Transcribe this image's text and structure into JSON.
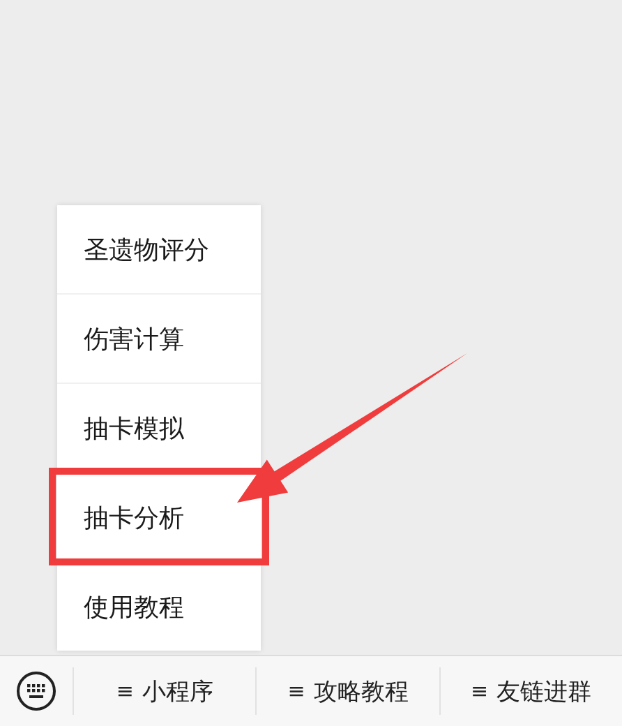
{
  "popup_menu": {
    "items": [
      {
        "label": "圣遗物评分",
        "highlighted": false
      },
      {
        "label": "伤害计算",
        "highlighted": false
      },
      {
        "label": "抽卡模拟",
        "highlighted": false
      },
      {
        "label": "抽卡分析",
        "highlighted": true
      },
      {
        "label": "使用教程",
        "highlighted": false
      }
    ]
  },
  "menu_bar": {
    "tabs": [
      {
        "icon": "≡",
        "label": "小程序"
      },
      {
        "icon": "≡",
        "label": "攻略教程"
      },
      {
        "icon": "≡",
        "label": "友链进群"
      }
    ]
  }
}
